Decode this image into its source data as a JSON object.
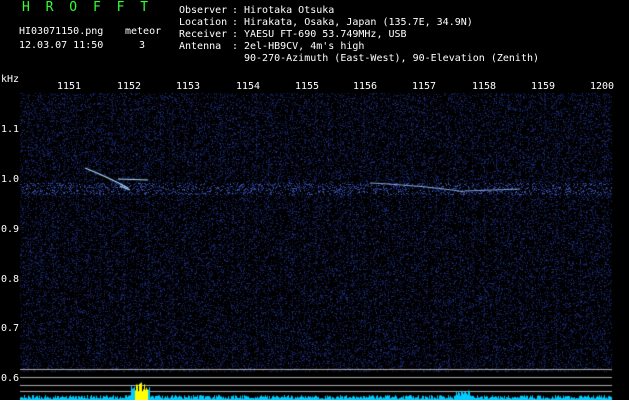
{
  "header": {
    "app_title": "H R O F F T",
    "filename": "HI03071150.png",
    "datetime": "12.03.07 11:50",
    "meteor_label": "meteor",
    "meteor_count": "3"
  },
  "station_info": [
    {
      "label": "Observer",
      "value": "Hirotaka Otsuka"
    },
    {
      "label": "Location",
      "value": "Hirakata, Osaka, Japan (135.7E, 34.9N)"
    },
    {
      "label": "Receiver",
      "value": "YAESU FT-690 53.749MHz, USB"
    },
    {
      "label": "Antenna",
      "value": "2el-HB9CV, 4m's high"
    },
    {
      "label": "",
      "value": "90-270-Azimuth (East-West), 90-Elevation (Zenith)"
    }
  ],
  "spectrogram": {
    "y_unit": "kHz",
    "x_ticks": [
      "1151",
      "1152",
      "1153",
      "1154",
      "1155",
      "1156",
      "1157",
      "1158",
      "1159",
      "1200"
    ],
    "y_ticks": [
      "1.1",
      "1.0",
      "0.9",
      "0.8",
      "0.7",
      "0.6"
    ],
    "colors": {
      "label_green": "#33ff33",
      "background": "#000000",
      "noise_blue": "#1a2a8a",
      "signal_cyan": "#aaddff",
      "level_cyan": "#00ccff",
      "level_peak_yellow": "#ffff00",
      "reference_line": "#aaaaaa"
    }
  }
}
